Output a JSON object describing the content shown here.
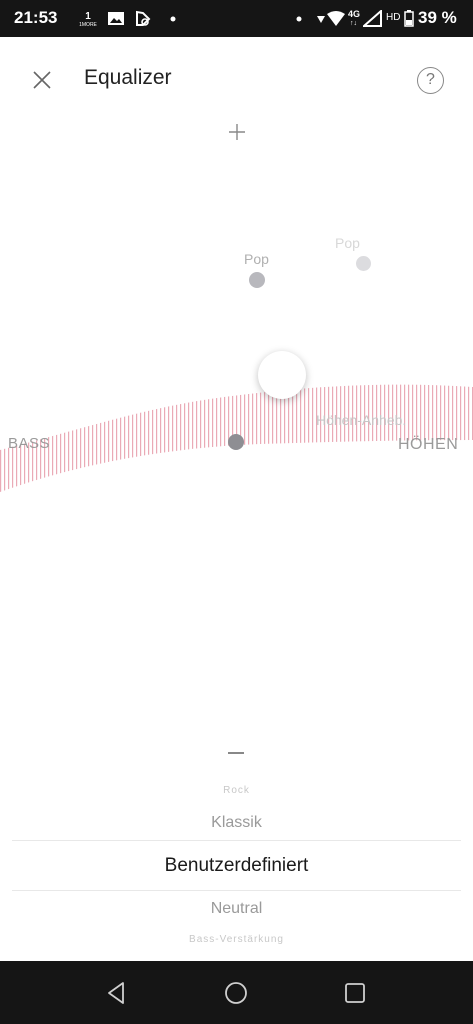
{
  "status_bar": {
    "time": "21:53",
    "network": "4G",
    "hd": "HD",
    "battery": "39 %",
    "icons": [
      "notification-1more-icon",
      "image-icon",
      "app-icon",
      "dot-icon",
      "wifi-icon",
      "signal-icon",
      "battery-icon"
    ]
  },
  "header": {
    "title": "Equalizer",
    "close_icon": "close-icon",
    "help_label": "?"
  },
  "equalizer": {
    "axis_left": "BASS",
    "axis_right": "HÖHEN",
    "presets_on_canvas": [
      {
        "label": "Pop"
      },
      {
        "label": "Pop"
      },
      {
        "label": "Höhen-Anheb."
      }
    ],
    "curve_color": "#e8a0ae"
  },
  "preset_picker": {
    "items": [
      "Rock",
      "Klassik",
      "Benutzerdefiniert",
      "Neutral",
      "Bass-Verstärkung"
    ],
    "selected": "Benutzerdefiniert"
  },
  "nav_bar": {
    "icons": [
      "back-icon",
      "home-icon",
      "recents-icon"
    ]
  }
}
